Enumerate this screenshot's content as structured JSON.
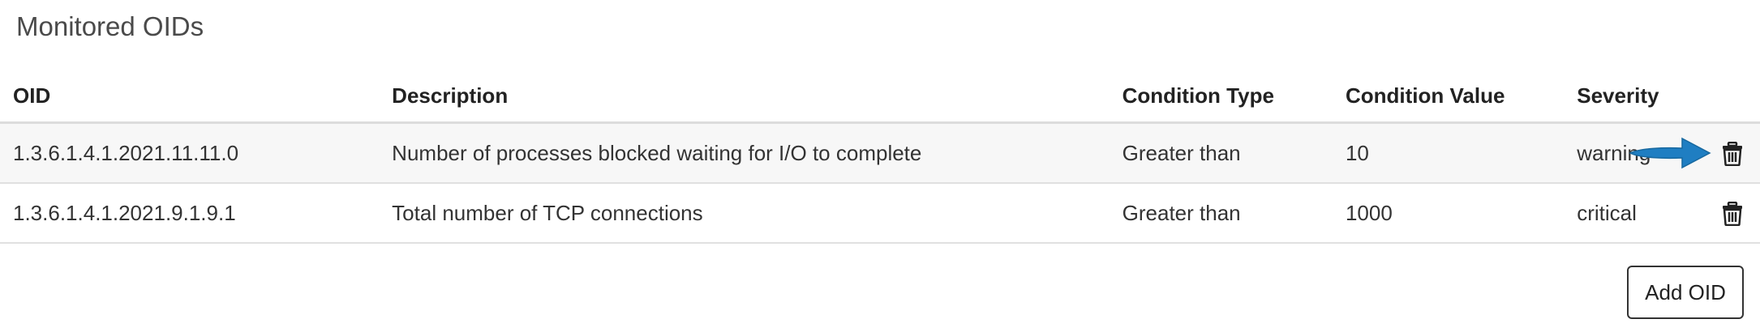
{
  "section": {
    "title": "Monitored OIDs"
  },
  "table": {
    "headers": {
      "oid": "OID",
      "description": "Description",
      "condition_type": "Condition Type",
      "condition_value": "Condition Value",
      "severity": "Severity"
    },
    "rows": [
      {
        "oid": "1.3.6.1.4.1.2021.11.11.0",
        "description": "Number of processes blocked waiting for I/O to complete",
        "condition_type": "Greater than",
        "condition_value": "10",
        "severity": "warning"
      },
      {
        "oid": "1.3.6.1.4.1.2021.9.1.9.1",
        "description": "Total number of TCP connections",
        "condition_type": "Greater than",
        "condition_value": "1000",
        "severity": "critical"
      }
    ]
  },
  "actions": {
    "add_label": "Add OID",
    "delete_icon": "trash-icon"
  },
  "annotation": {
    "arrow_color": "#1f7ec2",
    "arrow_icon": "arrow-right-icon"
  }
}
